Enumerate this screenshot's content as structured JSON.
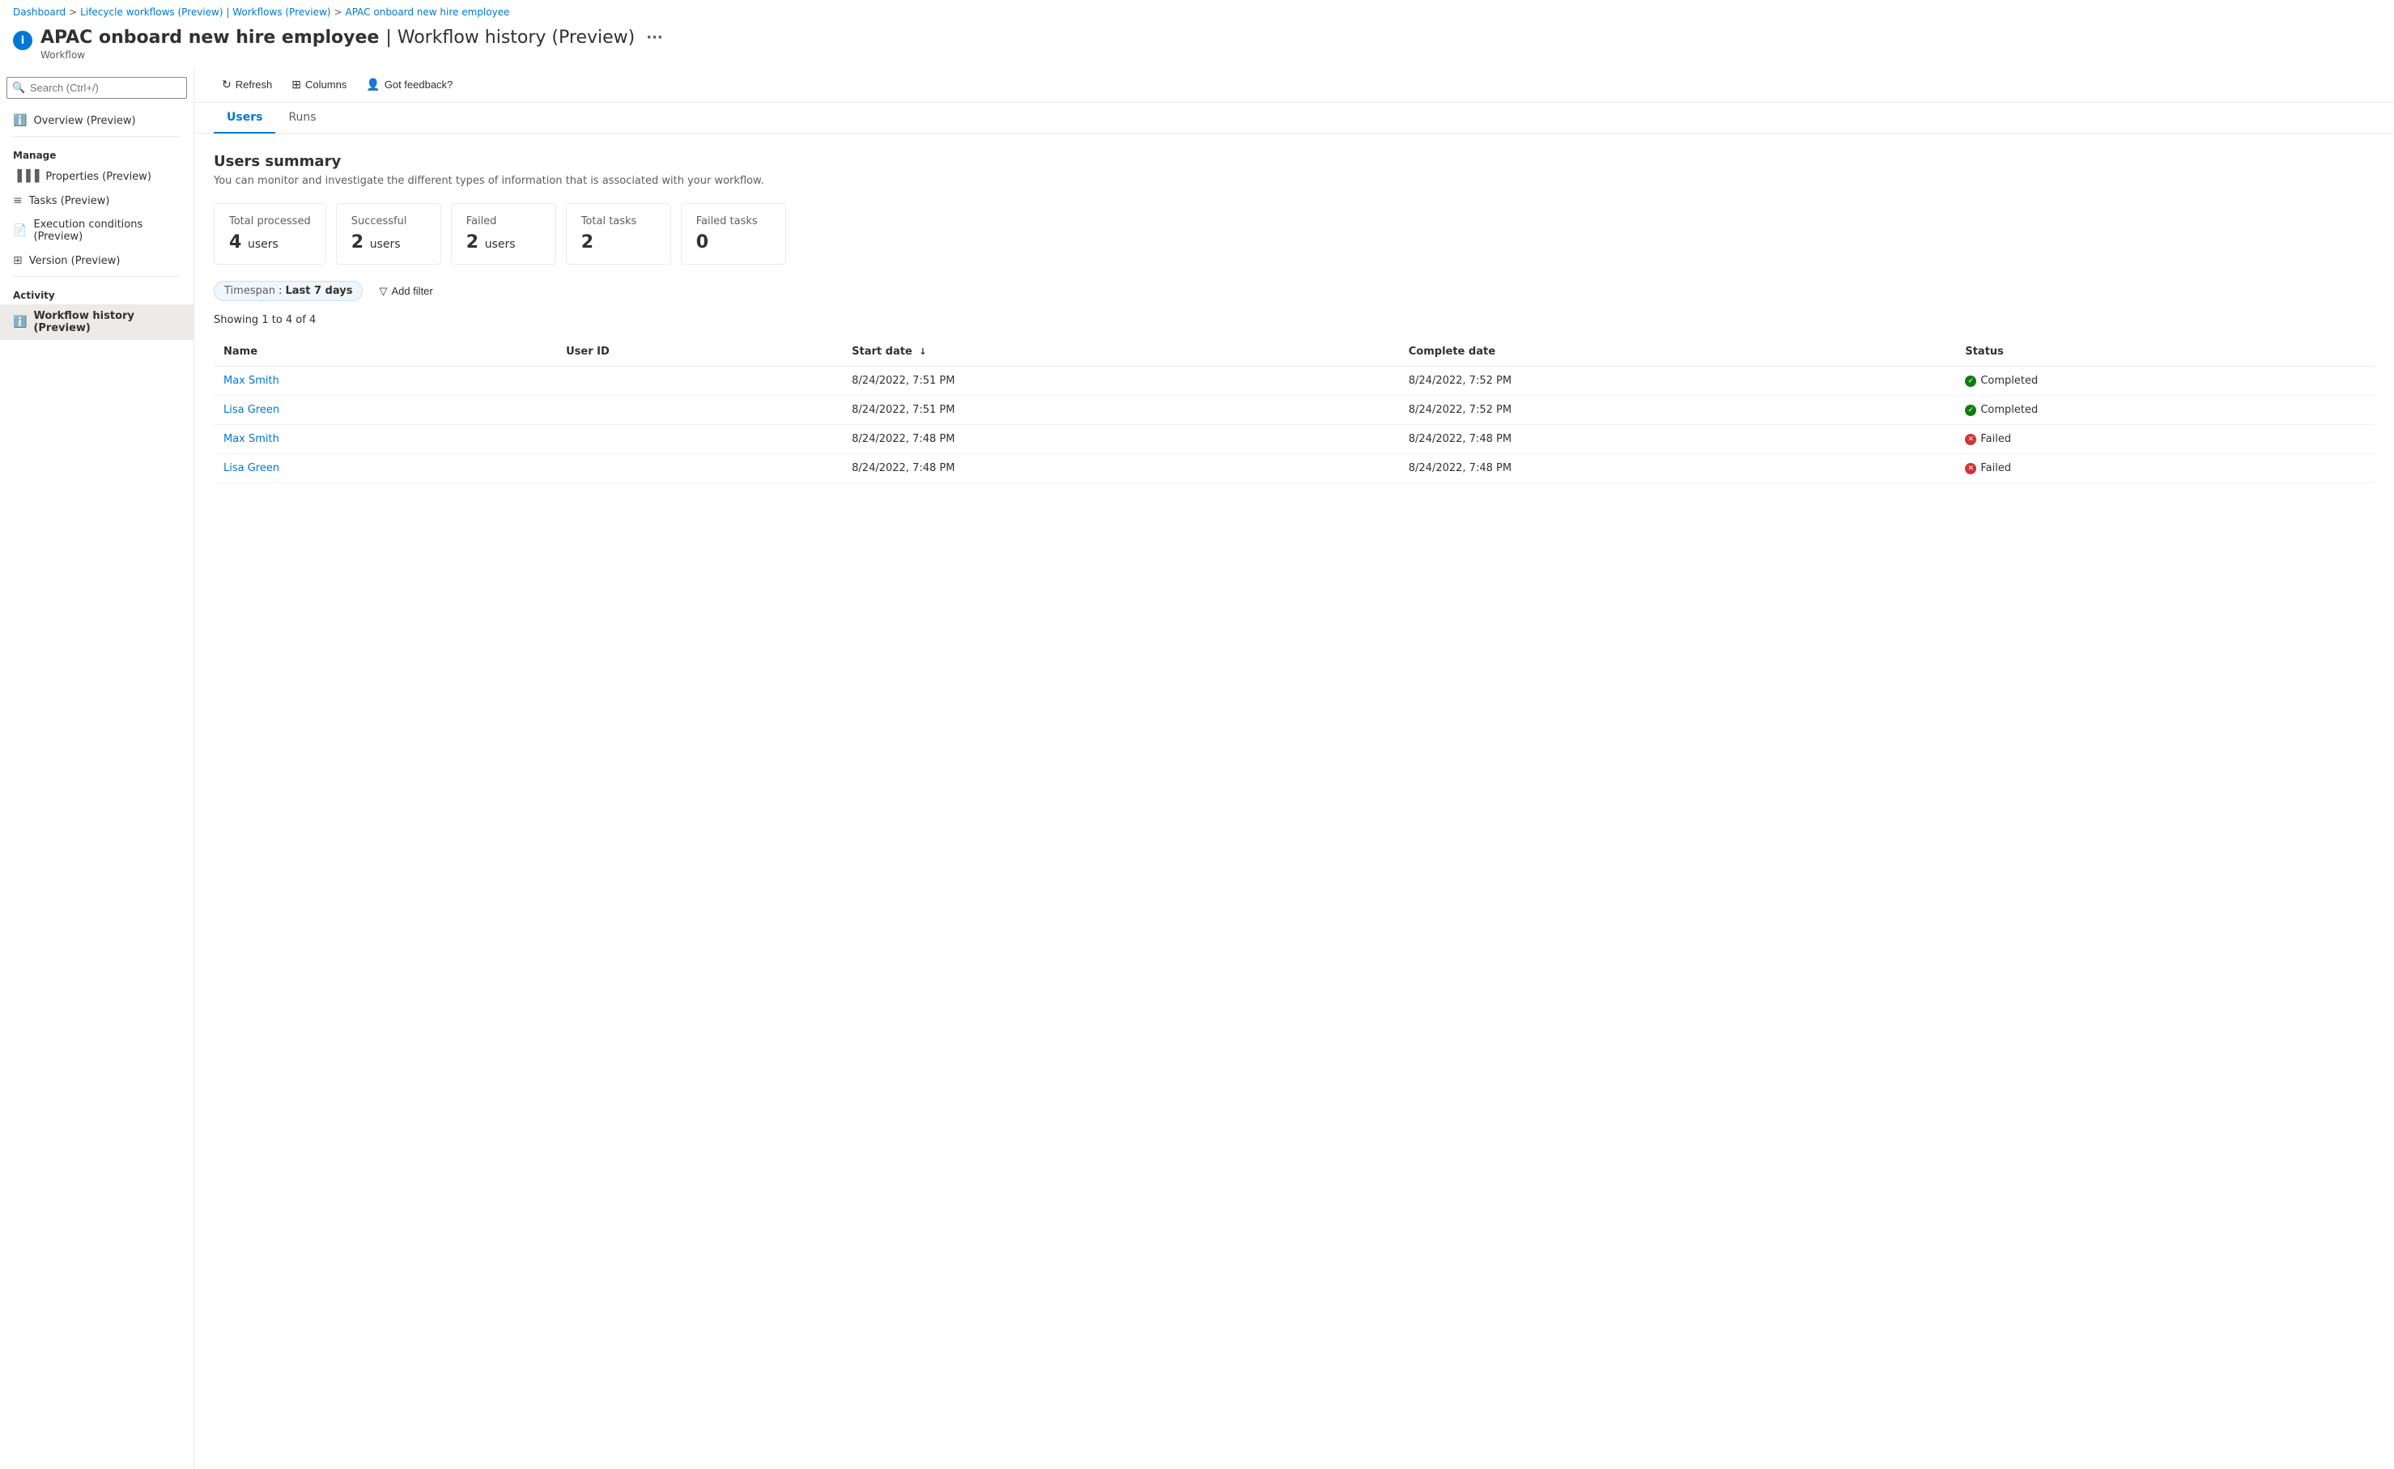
{
  "breadcrumb": {
    "items": [
      {
        "label": "Dashboard",
        "link": true
      },
      {
        "label": "Lifecycle workflows (Preview) | Workflows (Preview)",
        "link": true
      },
      {
        "label": "APAC onboard new hire employee",
        "link": true
      }
    ],
    "separators": [
      ">",
      ">"
    ]
  },
  "page": {
    "icon": "i",
    "title": "APAC onboard new hire employee",
    "title_suffix": "| Workflow history (Preview)",
    "subtitle": "Workflow"
  },
  "toolbar": {
    "refresh_label": "Refresh",
    "columns_label": "Columns",
    "feedback_label": "Got feedback?"
  },
  "sidebar": {
    "search_placeholder": "Search (Ctrl+/)",
    "overview_label": "Overview (Preview)",
    "manage_label": "Manage",
    "manage_items": [
      {
        "label": "Properties (Preview)",
        "icon": "bars"
      },
      {
        "label": "Tasks (Preview)",
        "icon": "list"
      },
      {
        "label": "Execution conditions (Preview)",
        "icon": "doc"
      },
      {
        "label": "Version (Preview)",
        "icon": "layers"
      }
    ],
    "activity_label": "Activity",
    "activity_items": [
      {
        "label": "Workflow history (Preview)",
        "icon": "info",
        "active": true
      }
    ]
  },
  "tabs": [
    {
      "label": "Users",
      "active": true
    },
    {
      "label": "Runs",
      "active": false
    }
  ],
  "summary": {
    "title": "Users summary",
    "description": "You can monitor and investigate the different types of information that is associated with your workflow.",
    "cards": [
      {
        "label": "Total processed",
        "value": "4",
        "unit": "users"
      },
      {
        "label": "Successful",
        "value": "2",
        "unit": "users"
      },
      {
        "label": "Failed",
        "value": "2",
        "unit": "users"
      },
      {
        "label": "Total tasks",
        "value": "2",
        "unit": ""
      },
      {
        "label": "Failed tasks",
        "value": "0",
        "unit": ""
      }
    ]
  },
  "filters": {
    "timespan_label": "Timespan",
    "timespan_value": "Last 7 days",
    "add_filter_label": "Add filter"
  },
  "table": {
    "showing_text": "Showing 1 to 4 of 4",
    "columns": [
      {
        "label": "Name",
        "sortable": false
      },
      {
        "label": "User ID",
        "sortable": false
      },
      {
        "label": "Start date",
        "sortable": true
      },
      {
        "label": "Complete date",
        "sortable": false
      },
      {
        "label": "Status",
        "sortable": false
      }
    ],
    "rows": [
      {
        "name": "Max Smith",
        "user_id": "",
        "start_date": "8/24/2022, 7:51 PM",
        "complete_date": "8/24/2022, 7:52 PM",
        "status": "Completed",
        "status_type": "completed"
      },
      {
        "name": "Lisa Green",
        "user_id": "",
        "start_date": "8/24/2022, 7:51 PM",
        "complete_date": "8/24/2022, 7:52 PM",
        "status": "Completed",
        "status_type": "completed"
      },
      {
        "name": "Max Smith",
        "user_id": "",
        "start_date": "8/24/2022, 7:48 PM",
        "complete_date": "8/24/2022, 7:48 PM",
        "status": "Failed",
        "status_type": "failed"
      },
      {
        "name": "Lisa Green",
        "user_id": "",
        "start_date": "8/24/2022, 7:48 PM",
        "complete_date": "8/24/2022, 7:48 PM",
        "status": "Failed",
        "status_type": "failed"
      }
    ]
  }
}
